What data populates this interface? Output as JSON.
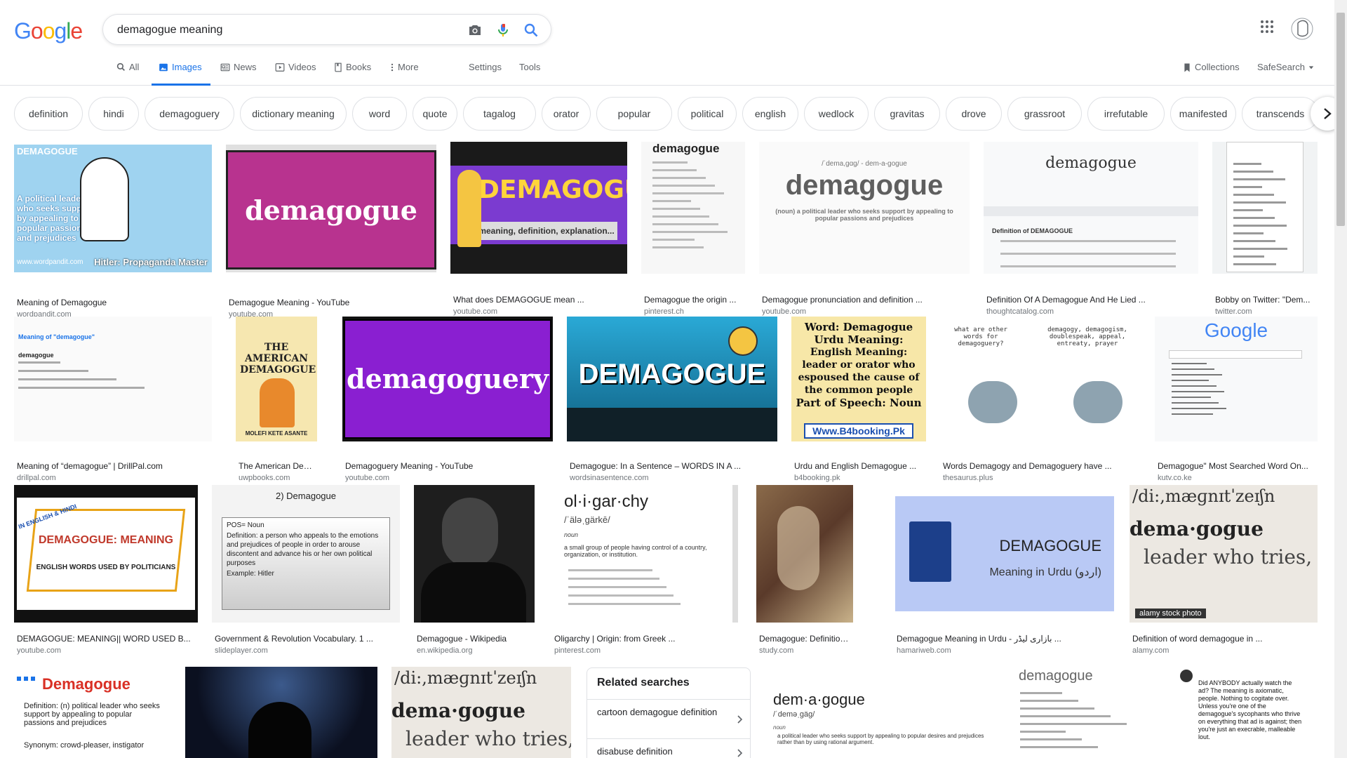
{
  "logo": {
    "letters": [
      "G",
      "o",
      "o",
      "g",
      "l",
      "e"
    ],
    "colors": [
      "#4285f4",
      "#ea4335",
      "#fbbc05",
      "#4285f4",
      "#34a853",
      "#ea4335"
    ]
  },
  "search": {
    "query": "demagogue meaning"
  },
  "nav": {
    "all": "All",
    "images": "Images",
    "news": "News",
    "videos": "Videos",
    "books": "Books",
    "more": "More",
    "settings": "Settings",
    "tools": "Tools",
    "collections": "Collections",
    "safesearch": "SafeSearch"
  },
  "chips": [
    "definition",
    "hindi",
    "demagoguery",
    "dictionary meaning",
    "word",
    "quote",
    "tagalog",
    "orator",
    "popular",
    "political",
    "english",
    "wedlock",
    "gravitas",
    "drove",
    "grassroot",
    "irrefutable",
    "manifested",
    "transcends"
  ],
  "results": [
    {
      "caption": "Meaning of Demagogue",
      "source": "wordpandit.com"
    },
    {
      "caption": "Demagogue Meaning - YouTube",
      "source": "youtube.com"
    },
    {
      "caption": "What does DEMAGOGUE mean ...",
      "source": "youtube.com"
    },
    {
      "caption": "Demagogue the origin ...",
      "source": "pinterest.ch"
    },
    {
      "caption": "Demagogue pronunciation and definition ...",
      "source": "youtube.com"
    },
    {
      "caption": "Definition Of A Demagogue And He Lied ...",
      "source": "thoughtcatalog.com"
    },
    {
      "caption": "Bobby on Twitter: \"Dem...",
      "source": "twitter.com"
    },
    {
      "caption": "Meaning of “demagogue” | DrillPal.com",
      "source": "drillpal.com"
    },
    {
      "caption": "The American Demag...",
      "source": "uwpbooks.com"
    },
    {
      "caption": "Demagoguery Meaning - YouTube",
      "source": "youtube.com"
    },
    {
      "caption": "Demagogue: In a Sentence – WORDS IN A ...",
      "source": "wordsinasentence.com"
    },
    {
      "caption": "Urdu and English Demagogue ...",
      "source": "b4booking.pk"
    },
    {
      "caption": "Words Demagogy and Demagoguery have ...",
      "source": "thesaurus.plus"
    },
    {
      "caption": "Demagogue\" Most Searched Word On...",
      "source": "kutv.co.ke"
    },
    {
      "caption": "DEMAGOGUE: MEANING|| WORD USED B...",
      "source": "youtube.com"
    },
    {
      "caption": "Government & Revolution Vocabulary. 1 ...",
      "source": "slideplayer.com"
    },
    {
      "caption": "Demagogue - Wikipedia",
      "source": "en.wikipedia.org"
    },
    {
      "caption": "Oligarchy | Origin: from Greek ...",
      "source": "pinterest.com"
    },
    {
      "caption": "Demagogue: Definition & O...",
      "source": "study.com"
    },
    {
      "caption": "Demagogue Meaning in Urdu - بازاری لیڈر ...",
      "source": "hamariweb.com"
    },
    {
      "caption": "Definition of word demagogue in ...",
      "source": "alamy.com"
    }
  ],
  "thumbs": {
    "t1_title": "DEMAGOGUE",
    "t1_body": "A political leader who seeks support by appealing to popular passions and prejudices",
    "t1_site": "www.wordpandit.com",
    "t1_footer": "Hitler: Propaganda Master",
    "t2": "demagogue",
    "t3": "DEMAGOGUE",
    "t3_sub": "meaning, definition, explanation...",
    "t4_word": "demagogue",
    "t5_word": "demagogue",
    "t5_phon": "/ˈdema,gɑg/ - dem-a-gogue",
    "t5_def": "(noun) a political leader who seeks support by appealing to popular passions and prejudices",
    "t6_word": "demagogue",
    "t6_sec": "Definition of DEMAGOGUE",
    "t8_title": "Meaning of \"demagogue\"",
    "t8_word": "demagogue",
    "t9_title": "THE AMERICAN DEMAGOGUE",
    "t9_author": "MOLEFI KETE ASANTE",
    "t10": "demagoguery",
    "t11": "DEMAGOGUE",
    "t12_a": "Word: Demagogue",
    "t12_b": "Urdu Meaning:",
    "t12_c": "English Meaning: leader or orator who espoused the cause of the common people",
    "t12_d": "Part of Speech: Noun",
    "t12_site": "Www.B4booking.Pk",
    "t13_q": "what are other words for demagoguery?",
    "t13_a": "demagogy, demagogism, doublespeak, appeal, entreaty, prayer",
    "t14_logo": "Google",
    "t15_a": "DEMAGOGUE: MEANING",
    "t15_b": "ENGLISH WORDS USED BY POLITICIANS",
    "t15_c": "IN ENGLISH & HINDI",
    "t16_title": "2) Demagogue",
    "t16_pos": "POS= Noun",
    "t16_def": "Definition: a person who appeals to the emotions and prejudices of people in order to arouse discontent and advance his or her own political purposes",
    "t16_ex": "Example: Hitler",
    "t18_word": "ol·i·gar·chy",
    "t18_phon": "/ˈäləˌgärkē/",
    "t18_noun": "noun",
    "t18_def": "a small group of people having control of a country, organization, or institution.",
    "t20_a": "DEMAGOGUE",
    "t20_b": "Meaning in Urdu (اردو)",
    "t21_a": "/di:,mæɡnɪtˈzeɪʃn",
    "t21_b": "dema·gogue",
    "t21_c": "leader who tries,",
    "t21_stamp": "alamy stock photo",
    "t22_title": "Demagogue",
    "t22_def": "Definition: (n) political leader who seeks support by appealing to popular passions and prejudices",
    "t22_syn": "Synonym: crowd-pleaser, instigator",
    "t25_word": "dem·a·gogue",
    "t25_phon": "/ˈdeməˌgäg/",
    "t25_noun": "noun",
    "t25_def": "a political leader who seeks support by appealing to popular desires and prejudices rather than by using rational argument.",
    "t26_word": "demagogue",
    "t27_text": "Did ANYBODY actually watch the ad? The meaning is axiomatic, people. Nothing to cogitate over. Unless you're one of the demagogue's sycophants who thrive on everything that ad is against; then you're just an execrable, malleable lout."
  },
  "related": {
    "title": "Related searches",
    "items": [
      "cartoon demagogue definition",
      "disabuse definition"
    ]
  }
}
